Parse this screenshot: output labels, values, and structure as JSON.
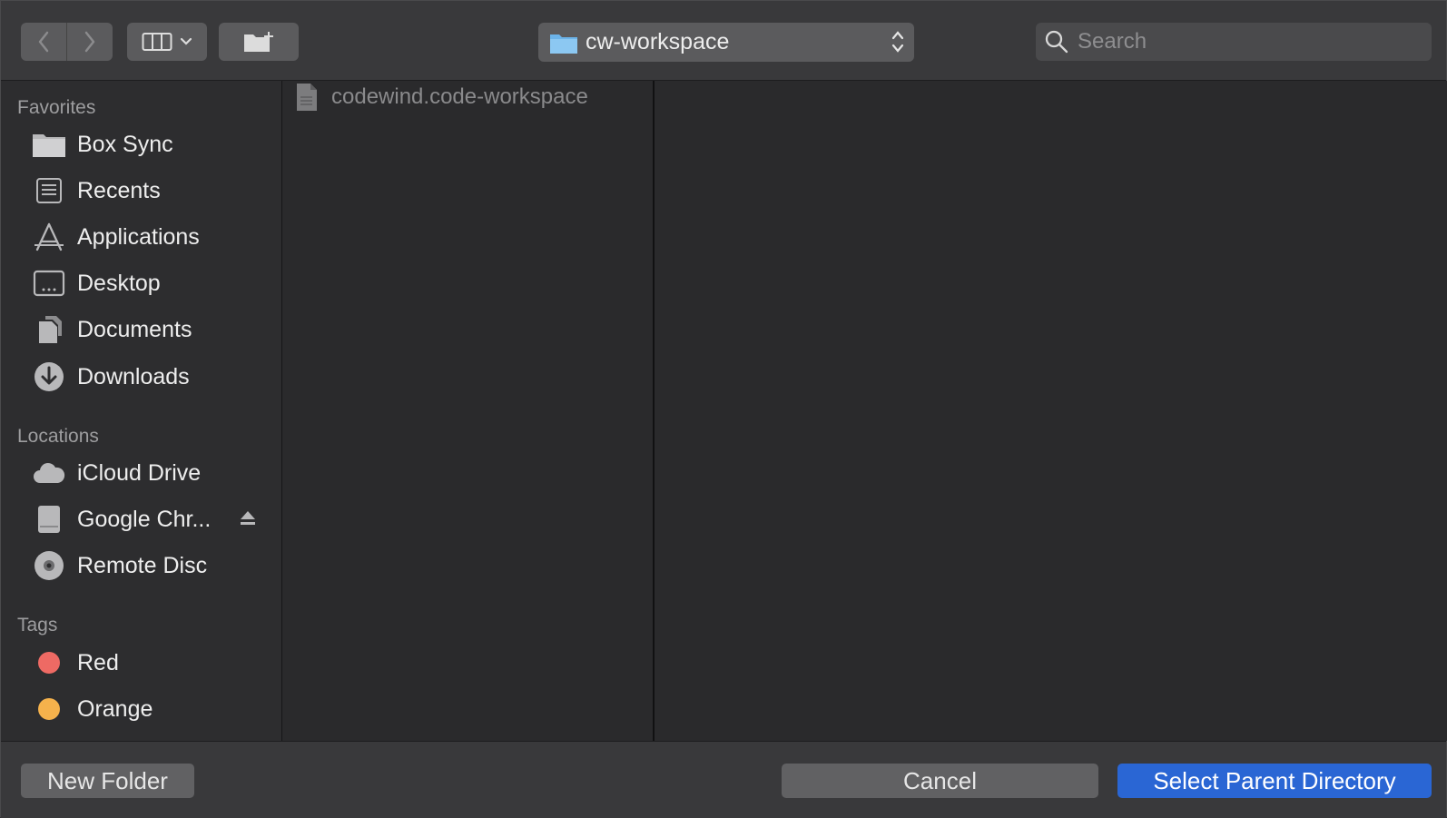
{
  "toolbar": {
    "back_icon": "chevron-left-icon",
    "forward_icon": "chevron-right-icon",
    "view_icon": "column-view-icon",
    "new_folder_icon": "new-folder-icon",
    "location": "cw-workspace",
    "search_placeholder": "Search"
  },
  "sidebar": {
    "favorites_title": "Favorites",
    "favorites": [
      {
        "label": "Box Sync",
        "icon": "folder-icon"
      },
      {
        "label": "Recents",
        "icon": "recents-icon"
      },
      {
        "label": "Applications",
        "icon": "applications-icon"
      },
      {
        "label": "Desktop",
        "icon": "desktop-icon"
      },
      {
        "label": "Documents",
        "icon": "documents-icon"
      },
      {
        "label": "Downloads",
        "icon": "downloads-icon"
      }
    ],
    "locations_title": "Locations",
    "locations": [
      {
        "label": "iCloud Drive",
        "icon": "cloud-icon"
      },
      {
        "label": "Google Chr...",
        "icon": "disk-icon"
      },
      {
        "label": "Remote Disc",
        "icon": "disc-icon"
      }
    ],
    "tags_title": "Tags",
    "tags": [
      {
        "label": "Red",
        "color": "#ee6a64"
      },
      {
        "label": "Orange",
        "color": "#f5b24c"
      }
    ]
  },
  "files": [
    {
      "name": "codewind.code-workspace",
      "icon": "document-icon"
    }
  ],
  "buttons": {
    "new_folder": "New Folder",
    "cancel": "Cancel",
    "select": "Select Parent Directory"
  },
  "colors": {
    "accent": "#2a66d4"
  }
}
